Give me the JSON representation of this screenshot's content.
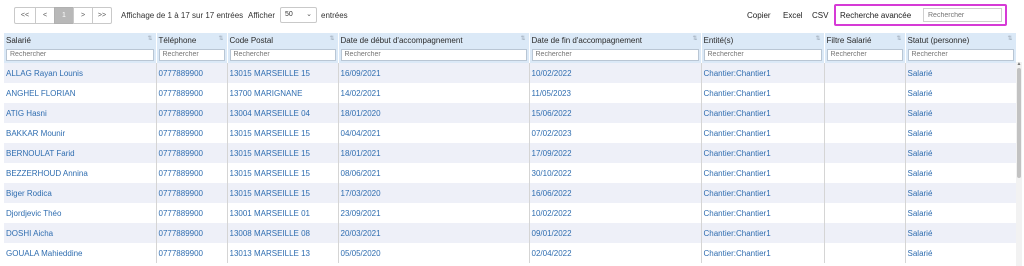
{
  "pager": {
    "first": "<<",
    "prev": "<",
    "current": "1",
    "next": ">",
    "last": ">>"
  },
  "info": "Affichage de 1 à 17 sur 17 entrées",
  "length": {
    "label": "Afficher",
    "value": "50",
    "suffix": "entrées"
  },
  "export": {
    "copy": "Copier",
    "excel": "Excel",
    "csv": "CSV"
  },
  "advanced_search": {
    "label": "Recherche avancée",
    "placeholder": "Rechercher"
  },
  "columns": [
    {
      "label": "Salarié",
      "placeholder": "Rechercher"
    },
    {
      "label": "Téléphone",
      "placeholder": "Rechercher"
    },
    {
      "label": "Code Postal",
      "placeholder": "Rechercher"
    },
    {
      "label": "Date de début d'accompagnement",
      "placeholder": "Rechercher"
    },
    {
      "label": "Date de fin d'accompagnement",
      "placeholder": "Rechercher"
    },
    {
      "label": "Entité(s)",
      "placeholder": "Rechercher"
    },
    {
      "label": "Filtre Salarié",
      "placeholder": "Rechercher"
    },
    {
      "label": "Statut (personne)",
      "placeholder": "Rechercher"
    }
  ],
  "rows": [
    [
      "ALLAG Rayan Lounis",
      "0777889900",
      "13015 MARSEILLE 15",
      "16/09/2021",
      "10/02/2022",
      "Chantier:Chantier1",
      "",
      "Salarié"
    ],
    [
      "ANGHEL FLORIAN",
      "0777889900",
      "13700 MARIGNANE",
      "14/02/2021",
      "11/05/2023",
      "Chantier:Chantier1",
      "",
      "Salarié"
    ],
    [
      "ATIG Hasni",
      "0777889900",
      "13004 MARSEILLE 04",
      "18/01/2020",
      "15/06/2022",
      "Chantier:Chantier1",
      "",
      "Salarié"
    ],
    [
      "BAKKAR Mounir",
      "0777889900",
      "13015 MARSEILLE 15",
      "04/04/2021",
      "07/02/2023",
      "Chantier:Chantier1",
      "",
      "Salarié"
    ],
    [
      "BERNOULAT Farid",
      "0777889900",
      "13015 MARSEILLE 15",
      "18/01/2021",
      "17/09/2022",
      "Chantier:Chantier1",
      "",
      "Salarié"
    ],
    [
      "BEZZERHOUD Annina",
      "0777889900",
      "13015 MARSEILLE 15",
      "08/06/2021",
      "30/10/2022",
      "Chantier:Chantier1",
      "",
      "Salarié"
    ],
    [
      "Biger Rodica",
      "0777889900",
      "13015 MARSEILLE 15",
      "17/03/2020",
      "16/06/2022",
      "Chantier:Chantier1",
      "",
      "Salarié"
    ],
    [
      "Djordjevic Théo",
      "0777889900",
      "13001 MARSEILLE 01",
      "23/09/2021",
      "10/02/2022",
      "Chantier:Chantier1",
      "",
      "Salarié"
    ],
    [
      "DOSHI Aicha",
      "0777889900",
      "13008 MARSEILLE 08",
      "20/03/2021",
      "09/01/2022",
      "Chantier:Chantier1",
      "",
      "Salarié"
    ],
    [
      "GOUALA Mahieddine",
      "0777889900",
      "13013 MARSEILLE 13",
      "05/05/2020",
      "02/04/2022",
      "Chantier:Chantier1",
      "",
      "Salarié"
    ]
  ]
}
